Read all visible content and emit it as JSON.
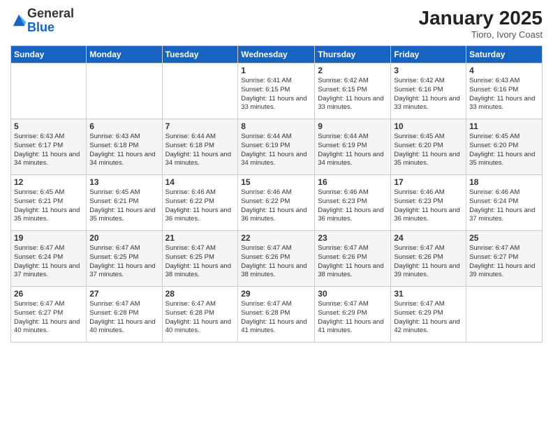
{
  "header": {
    "logo_general": "General",
    "logo_blue": "Blue",
    "month_year": "January 2025",
    "location": "Tioro, Ivory Coast"
  },
  "days_of_week": [
    "Sunday",
    "Monday",
    "Tuesday",
    "Wednesday",
    "Thursday",
    "Friday",
    "Saturday"
  ],
  "weeks": [
    [
      {
        "day": "",
        "info": ""
      },
      {
        "day": "",
        "info": ""
      },
      {
        "day": "",
        "info": ""
      },
      {
        "day": "1",
        "info": "Sunrise: 6:41 AM\nSunset: 6:15 PM\nDaylight: 11 hours\nand 33 minutes."
      },
      {
        "day": "2",
        "info": "Sunrise: 6:42 AM\nSunset: 6:15 PM\nDaylight: 11 hours\nand 33 minutes."
      },
      {
        "day": "3",
        "info": "Sunrise: 6:42 AM\nSunset: 6:16 PM\nDaylight: 11 hours\nand 33 minutes."
      },
      {
        "day": "4",
        "info": "Sunrise: 6:43 AM\nSunset: 6:16 PM\nDaylight: 11 hours\nand 33 minutes."
      }
    ],
    [
      {
        "day": "5",
        "info": "Sunrise: 6:43 AM\nSunset: 6:17 PM\nDaylight: 11 hours\nand 34 minutes."
      },
      {
        "day": "6",
        "info": "Sunrise: 6:43 AM\nSunset: 6:18 PM\nDaylight: 11 hours\nand 34 minutes."
      },
      {
        "day": "7",
        "info": "Sunrise: 6:44 AM\nSunset: 6:18 PM\nDaylight: 11 hours\nand 34 minutes."
      },
      {
        "day": "8",
        "info": "Sunrise: 6:44 AM\nSunset: 6:19 PM\nDaylight: 11 hours\nand 34 minutes."
      },
      {
        "day": "9",
        "info": "Sunrise: 6:44 AM\nSunset: 6:19 PM\nDaylight: 11 hours\nand 34 minutes."
      },
      {
        "day": "10",
        "info": "Sunrise: 6:45 AM\nSunset: 6:20 PM\nDaylight: 11 hours\nand 35 minutes."
      },
      {
        "day": "11",
        "info": "Sunrise: 6:45 AM\nSunset: 6:20 PM\nDaylight: 11 hours\nand 35 minutes."
      }
    ],
    [
      {
        "day": "12",
        "info": "Sunrise: 6:45 AM\nSunset: 6:21 PM\nDaylight: 11 hours\nand 35 minutes."
      },
      {
        "day": "13",
        "info": "Sunrise: 6:45 AM\nSunset: 6:21 PM\nDaylight: 11 hours\nand 35 minutes."
      },
      {
        "day": "14",
        "info": "Sunrise: 6:46 AM\nSunset: 6:22 PM\nDaylight: 11 hours\nand 36 minutes."
      },
      {
        "day": "15",
        "info": "Sunrise: 6:46 AM\nSunset: 6:22 PM\nDaylight: 11 hours\nand 36 minutes."
      },
      {
        "day": "16",
        "info": "Sunrise: 6:46 AM\nSunset: 6:23 PM\nDaylight: 11 hours\nand 36 minutes."
      },
      {
        "day": "17",
        "info": "Sunrise: 6:46 AM\nSunset: 6:23 PM\nDaylight: 11 hours\nand 36 minutes."
      },
      {
        "day": "18",
        "info": "Sunrise: 6:46 AM\nSunset: 6:24 PM\nDaylight: 11 hours\nand 37 minutes."
      }
    ],
    [
      {
        "day": "19",
        "info": "Sunrise: 6:47 AM\nSunset: 6:24 PM\nDaylight: 11 hours\nand 37 minutes."
      },
      {
        "day": "20",
        "info": "Sunrise: 6:47 AM\nSunset: 6:25 PM\nDaylight: 11 hours\nand 37 minutes."
      },
      {
        "day": "21",
        "info": "Sunrise: 6:47 AM\nSunset: 6:25 PM\nDaylight: 11 hours\nand 38 minutes."
      },
      {
        "day": "22",
        "info": "Sunrise: 6:47 AM\nSunset: 6:26 PM\nDaylight: 11 hours\nand 38 minutes."
      },
      {
        "day": "23",
        "info": "Sunrise: 6:47 AM\nSunset: 6:26 PM\nDaylight: 11 hours\nand 38 minutes."
      },
      {
        "day": "24",
        "info": "Sunrise: 6:47 AM\nSunset: 6:26 PM\nDaylight: 11 hours\nand 39 minutes."
      },
      {
        "day": "25",
        "info": "Sunrise: 6:47 AM\nSunset: 6:27 PM\nDaylight: 11 hours\nand 39 minutes."
      }
    ],
    [
      {
        "day": "26",
        "info": "Sunrise: 6:47 AM\nSunset: 6:27 PM\nDaylight: 11 hours\nand 40 minutes."
      },
      {
        "day": "27",
        "info": "Sunrise: 6:47 AM\nSunset: 6:28 PM\nDaylight: 11 hours\nand 40 minutes."
      },
      {
        "day": "28",
        "info": "Sunrise: 6:47 AM\nSunset: 6:28 PM\nDaylight: 11 hours\nand 40 minutes."
      },
      {
        "day": "29",
        "info": "Sunrise: 6:47 AM\nSunset: 6:28 PM\nDaylight: 11 hours\nand 41 minutes."
      },
      {
        "day": "30",
        "info": "Sunrise: 6:47 AM\nSunset: 6:29 PM\nDaylight: 11 hours\nand 41 minutes."
      },
      {
        "day": "31",
        "info": "Sunrise: 6:47 AM\nSunset: 6:29 PM\nDaylight: 11 hours\nand 42 minutes."
      },
      {
        "day": "",
        "info": ""
      }
    ]
  ]
}
